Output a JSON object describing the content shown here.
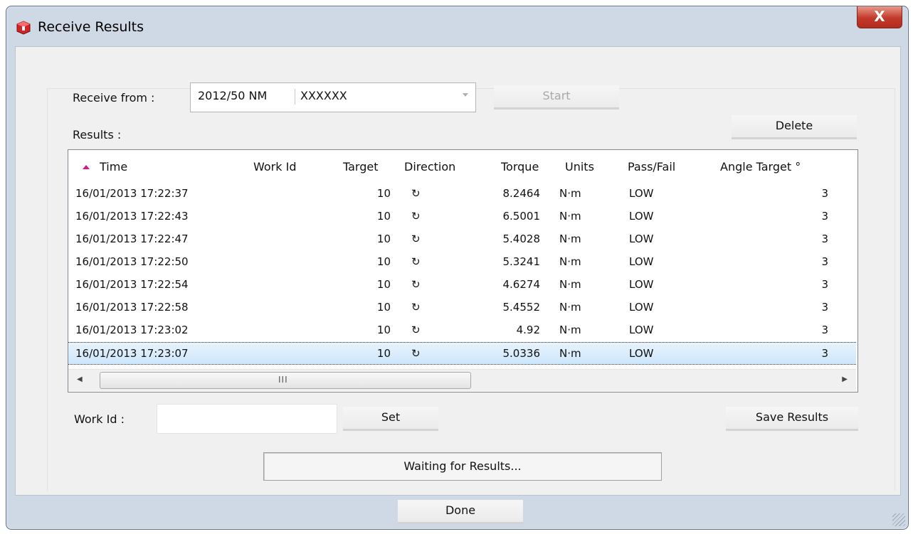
{
  "window": {
    "title": "Receive Results",
    "close_label": "X",
    "app_icon": "red-cube-icon"
  },
  "receive_from": {
    "label": "Receive from :",
    "device": "2012/50 NM",
    "serial": "XXXXXX",
    "start_label": "Start"
  },
  "results": {
    "label": "Results :",
    "delete_label": "Delete",
    "columns": [
      "Time",
      "Work Id",
      "Target",
      "Direction",
      "Torque",
      "Units",
      "Pass/Fail",
      "Angle Target °"
    ],
    "sort_icon": "sort-ascending-icon",
    "direction_icon": "clockwise-arrow-icon",
    "rows": [
      {
        "time": "16/01/2013 17:22:37",
        "work_id": "",
        "target": "10",
        "direction": "↻",
        "torque": "8.2464",
        "units": "N·m",
        "pass_fail": "LOW",
        "angle_target": "3"
      },
      {
        "time": "16/01/2013 17:22:43",
        "work_id": "",
        "target": "10",
        "direction": "↻",
        "torque": "6.5001",
        "units": "N·m",
        "pass_fail": "LOW",
        "angle_target": "3"
      },
      {
        "time": "16/01/2013 17:22:47",
        "work_id": "",
        "target": "10",
        "direction": "↻",
        "torque": "5.4028",
        "units": "N·m",
        "pass_fail": "LOW",
        "angle_target": "3"
      },
      {
        "time": "16/01/2013 17:22:50",
        "work_id": "",
        "target": "10",
        "direction": "↻",
        "torque": "5.3241",
        "units": "N·m",
        "pass_fail": "LOW",
        "angle_target": "3"
      },
      {
        "time": "16/01/2013 17:22:54",
        "work_id": "",
        "target": "10",
        "direction": "↻",
        "torque": "4.6274",
        "units": "N·m",
        "pass_fail": "LOW",
        "angle_target": "3"
      },
      {
        "time": "16/01/2013 17:22:58",
        "work_id": "",
        "target": "10",
        "direction": "↻",
        "torque": "5.4552",
        "units": "N·m",
        "pass_fail": "LOW",
        "angle_target": "3"
      },
      {
        "time": "16/01/2013 17:23:02",
        "work_id": "",
        "target": "10",
        "direction": "↻",
        "torque": "4.92",
        "units": "N·m",
        "pass_fail": "LOW",
        "angle_target": "3"
      },
      {
        "time": "16/01/2013 17:23:07",
        "work_id": "",
        "target": "10",
        "direction": "↻",
        "torque": "5.0336",
        "units": "N·m",
        "pass_fail": "LOW",
        "angle_target": "3"
      }
    ],
    "scroll_grip": "III"
  },
  "work_id": {
    "label": "Work Id :",
    "value": "",
    "set_label": "Set"
  },
  "save_results_label": "Save Results",
  "status_text": "Waiting for Results...",
  "done_label": "Done",
  "colors": {
    "selection": "#cde6fb",
    "sort_indicator": "#d21a8c",
    "close_button": "#c2392a"
  }
}
